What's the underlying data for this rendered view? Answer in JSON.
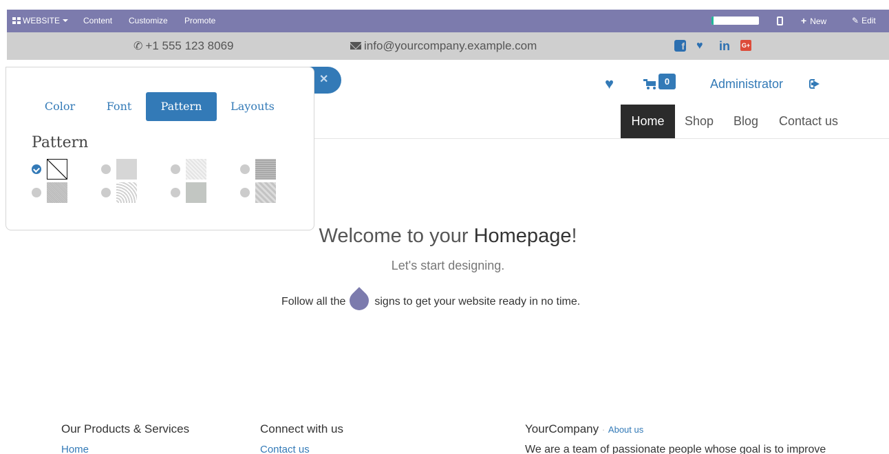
{
  "admin_bar": {
    "app_label": "WEBSITE",
    "menu": [
      "Content",
      "Customize",
      "Promote"
    ],
    "progress_fraction": 0.05,
    "new_label": "New",
    "edit_label": "Edit"
  },
  "contact_bar": {
    "phone": "+1 555 123 8069",
    "email": "info@yourcompany.example.com",
    "social_icons": [
      "facebook-icon",
      "twitter-icon",
      "linkedin-icon",
      "google-plus-icon"
    ]
  },
  "header": {
    "cart_count": "0",
    "user_name": "Administrator",
    "nav": [
      "Home",
      "Shop",
      "Blog",
      "Contact us"
    ],
    "active_nav": "Home"
  },
  "customize_popover": {
    "tabs": [
      "Color",
      "Font",
      "Pattern",
      "Layouts"
    ],
    "active_tab": "Pattern",
    "heading": "Pattern",
    "selected_pattern_index": 0
  },
  "hero": {
    "welcome_prefix": "Welcome to your ",
    "welcome_bold": "Homepage",
    "welcome_suffix": "!",
    "subtitle": "Let's start designing.",
    "follow_prefix": "Follow all the",
    "follow_suffix": "signs to get your website ready in no time."
  },
  "footer": {
    "col1_heading": "Our Products & Services",
    "col1_link": "Home",
    "col2_heading": "Connect with us",
    "col2_link": "Contact us",
    "col3_heading": "YourCompany",
    "col3_about": "About us",
    "col3_text": "We are a team of passionate people whose goal is to improve"
  },
  "colors": {
    "admin_bar": "#7c7bad",
    "brand_blue": "#337ab7",
    "active_nav_bg": "#2b2b2b",
    "contact_bar": "#cfcfcf"
  }
}
